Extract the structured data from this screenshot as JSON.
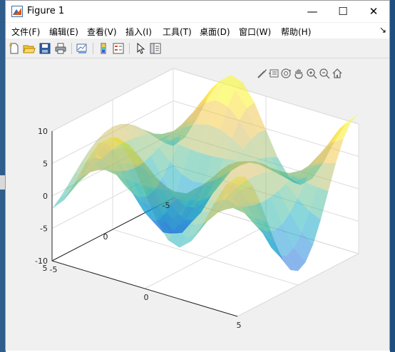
{
  "window": {
    "title": "Figure 1",
    "minimize": "—",
    "maximize": "☐",
    "close": "✕"
  },
  "menu": {
    "items": [
      "文件(F)",
      "编辑(E)",
      "查看(V)",
      "插入(I)",
      "工具(T)",
      "桌面(D)",
      "窗口(W)",
      "帮助(H)"
    ],
    "overflow": "↘"
  },
  "toolbar": {
    "icons": [
      "new-figure-icon",
      "open-file-icon",
      "save-icon",
      "print-icon",
      "link-plot-icon",
      "insert-colorbar-icon",
      "insert-legend-icon",
      "cursor-icon",
      "property-inspector-icon"
    ]
  },
  "axes_toolbar": {
    "icons": [
      "brush-icon",
      "data-tips-icon",
      "rotate-3d-icon",
      "pan-icon",
      "zoom-in-icon",
      "zoom-out-icon",
      "home-icon"
    ]
  },
  "plot": {
    "type": "surface-3d",
    "x_ticks": [
      "-5",
      "0",
      "5"
    ],
    "y_ticks": [
      "5",
      "0",
      "-5"
    ],
    "z_ticks": [
      "10",
      "5",
      "0",
      "-5",
      "-10"
    ],
    "zlim": [
      -10,
      10
    ],
    "grid": true,
    "face_alpha": 0.5,
    "colormap": "parula"
  }
}
